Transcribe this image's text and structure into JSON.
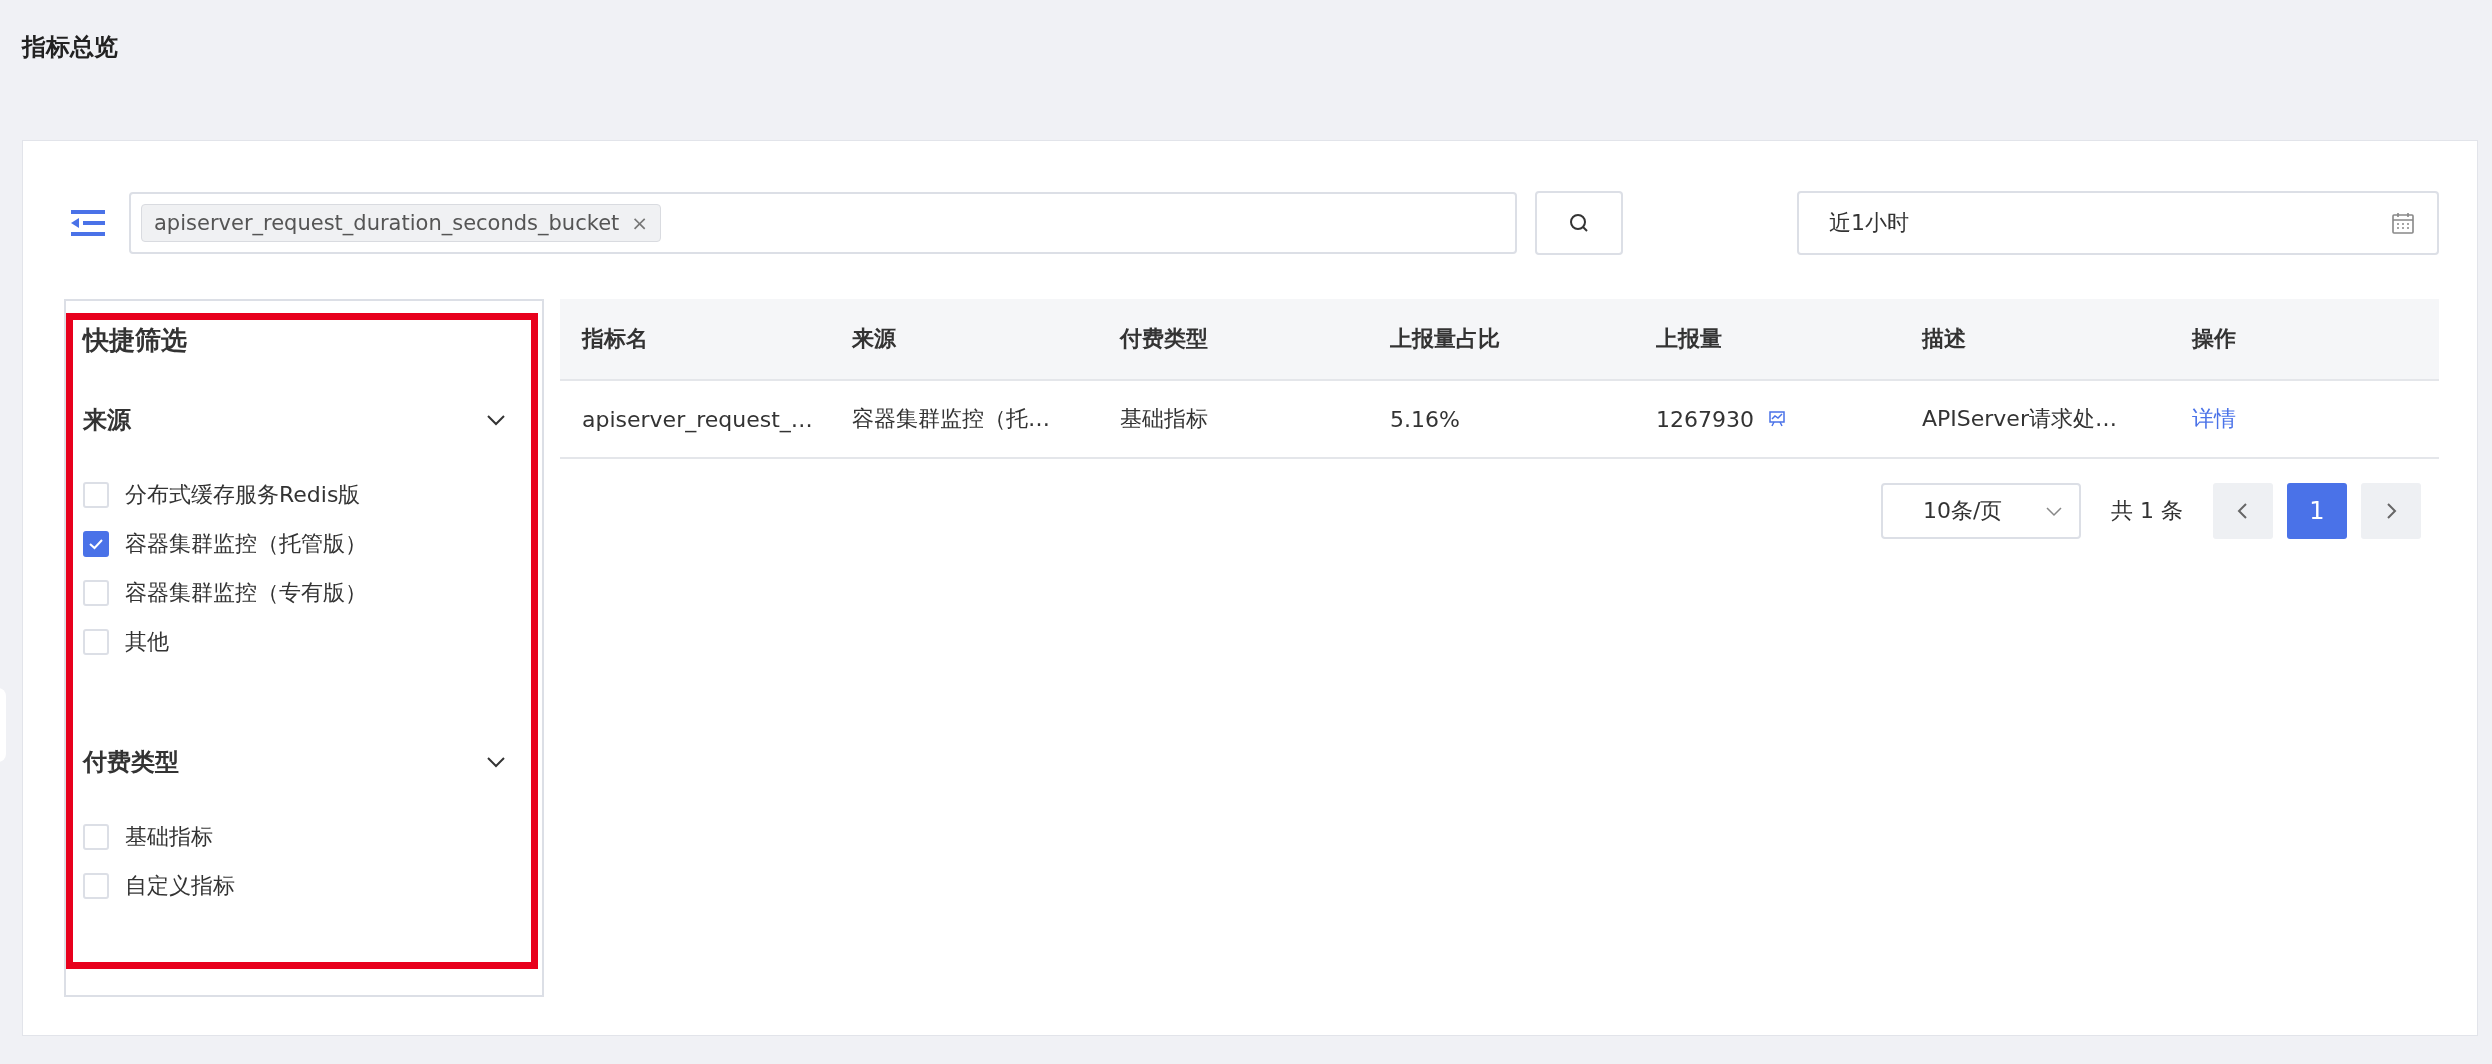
{
  "page_title": "指标总览",
  "search": {
    "tags": [
      {
        "label": "apiserver_request_duration_seconds_bucket",
        "remove": "×"
      }
    ]
  },
  "time_range": {
    "value": "近1小时"
  },
  "quick_filter": {
    "title": "快捷筛选",
    "groups": [
      {
        "title": "来源",
        "expanded": true,
        "options": [
          {
            "label": "分布式缓存服务Redis版",
            "checked": false
          },
          {
            "label": "容器集群监控（托管版）",
            "checked": true
          },
          {
            "label": "容器集群监控（专有版）",
            "checked": false
          },
          {
            "label": "其他",
            "checked": false
          }
        ]
      },
      {
        "title": "付费类型",
        "expanded": true,
        "options": [
          {
            "label": "基础指标",
            "checked": false
          },
          {
            "label": "自定义指标",
            "checked": false
          }
        ]
      }
    ]
  },
  "table": {
    "columns": [
      "指标名",
      "来源",
      "付费类型",
      "上报量占比",
      "上报量",
      "描述",
      "操作"
    ],
    "rows": [
      {
        "cells": [
          {
            "kind": "text",
            "text": "apiserver_request_…"
          },
          {
            "kind": "text",
            "text": "容器集群监控（托…"
          },
          {
            "kind": "text",
            "text": "基础指标"
          },
          {
            "kind": "text",
            "text": "5.16%"
          },
          {
            "kind": "count",
            "text": "1267930"
          },
          {
            "kind": "text",
            "text": "APIServer请求处…"
          },
          {
            "kind": "link",
            "text": "详情"
          }
        ]
      }
    ]
  },
  "pagination": {
    "page_size": "10条/页",
    "total": "共 1 条",
    "pages": [
      {
        "label": "1",
        "selected": true
      }
    ]
  }
}
